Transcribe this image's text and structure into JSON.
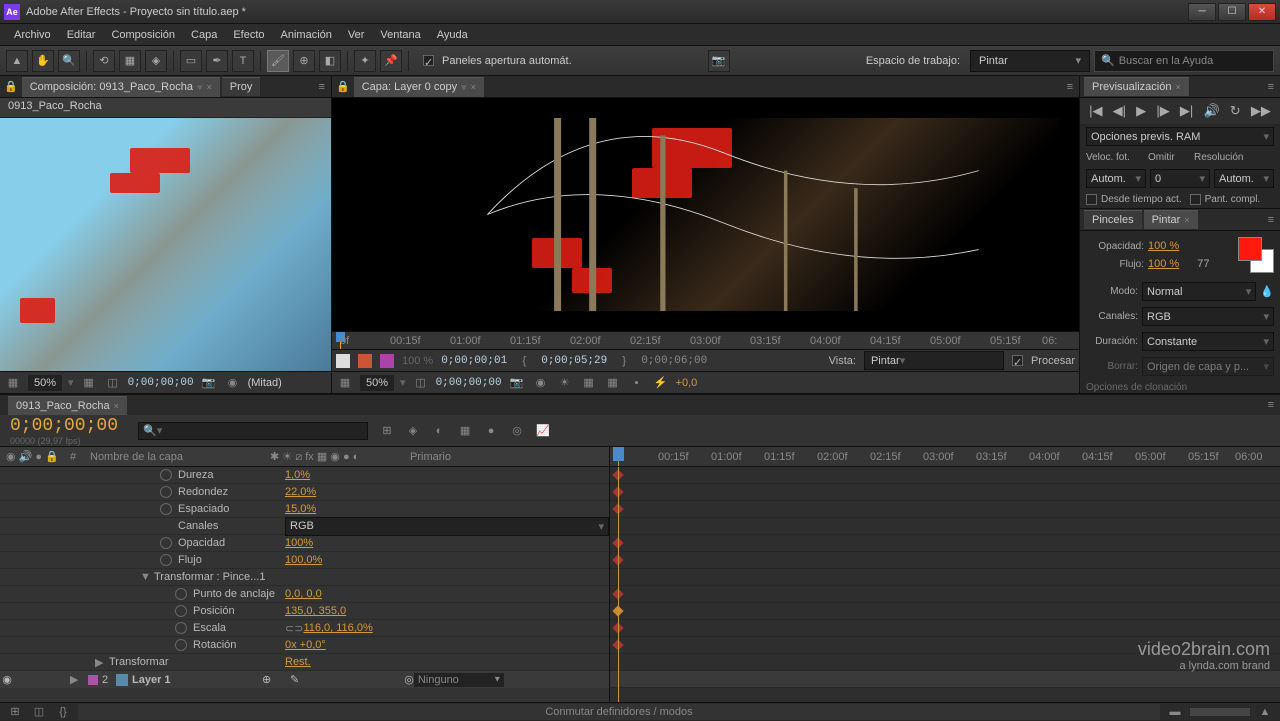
{
  "app": {
    "title": "Adobe After Effects - Proyecto sin título.aep *",
    "icon_text": "Ae"
  },
  "menu": [
    "Archivo",
    "Editar",
    "Composición",
    "Capa",
    "Efecto",
    "Animación",
    "Ver",
    "Ventana",
    "Ayuda"
  ],
  "toolbar": {
    "panels_auto": "Paneles apertura automát.",
    "workspace_label": "Espacio de trabajo:",
    "workspace_value": "Pintar",
    "help_placeholder": "Buscar en la Ayuda"
  },
  "left_panel": {
    "comp_tab": "Composición: 0913_Paco_Rocha",
    "proj_tab": "Proy",
    "comp_name": "0913_Paco_Rocha",
    "zoom": "50%",
    "timecode": "0;00;00;00",
    "resolution": "(Mitad)"
  },
  "center_panel": {
    "layer_tab": "Capa: Layer 0 copy",
    "zoom": "50%",
    "timecode": "0;00;00;00",
    "time_in": "0;00;00;01",
    "time_out": "0;00;05;29",
    "time_cur": "0;00;06;00",
    "vista_label": "Vista:",
    "vista_value": "Pintar",
    "procesar": "Procesar",
    "plus_value": "+0,0",
    "ruler_marks": [
      "0f",
      "00:15f",
      "01:00f",
      "01:15f",
      "02:00f",
      "02:15f",
      "03:00f",
      "03:15f",
      "04:00f",
      "04:15f",
      "05:00f",
      "05:15f",
      "06:"
    ]
  },
  "right_panel": {
    "preview_tab": "Previsualización",
    "ram_preview": "Opciones previs. RAM",
    "frame_rate_label": "Veloc. fot.",
    "skip_label": "Omitir",
    "resolution_label": "Resolución",
    "frame_rate": "Autom.",
    "skip": "0",
    "resolution": "Autom.",
    "from_current": "Desde tiempo act.",
    "full_screen": "Pant. compl.",
    "brushes_tab": "Pinceles",
    "paint_tab": "Pintar",
    "opacity_label": "Opacidad:",
    "opacity_value": "100 %",
    "flow_label": "Flujo:",
    "flow_value": "100 %",
    "size_value": "77",
    "mode_label": "Modo:",
    "mode_value": "Normal",
    "channels_label": "Canales:",
    "channels_value": "RGB",
    "duration_label": "Duración:",
    "duration_value": "Constante",
    "erase_label": "Borrar:",
    "erase_value": "Origen de capa y p...",
    "clone_options": "Opciones de clonación"
  },
  "timeline": {
    "tab": "0913_Paco_Rocha",
    "timecode": "0;00;00;00",
    "fps": "00000 (29,97 fps)",
    "col_num": "#",
    "col_name": "Nombre de la capa",
    "col_parent": "Primario",
    "ruler_marks": [
      "00:15f",
      "01:00f",
      "01:15f",
      "02:00f",
      "02:15f",
      "03:00f",
      "03:15f",
      "04:00f",
      "04:15f",
      "05:00f",
      "05:15f",
      "06:00"
    ],
    "props": [
      {
        "name": "Dureza",
        "value": "1,0%"
      },
      {
        "name": "Redondez",
        "value": "22,0%"
      },
      {
        "name": "Espaciado",
        "value": "15,0%"
      },
      {
        "name": "Canales",
        "value": "RGB",
        "dropdown": true,
        "no_stopwatch": true
      },
      {
        "name": "Opacidad",
        "value": "100%"
      },
      {
        "name": "Flujo",
        "value": "100,0%"
      }
    ],
    "transform_group": "Transformar : Pince...1",
    "transform_props": [
      {
        "name": "Punto de anclaje",
        "value": "0,0, 0,0"
      },
      {
        "name": "Posición",
        "value": "135,0, 355,0"
      },
      {
        "name": "Escala",
        "value": "116,0, 116,0%",
        "link": true
      },
      {
        "name": "Rotación",
        "value": "0x +0,0°"
      }
    ],
    "layer_transform": "Transformar",
    "layer_transform_value": "Rest.",
    "layer_num": "2",
    "layer_name": "Layer 1",
    "parent_value": "Ninguno",
    "footer_toggle": "Conmutar definidores / modos"
  },
  "watermark": {
    "line1": "video2brain.com",
    "line2": "a lynda.com brand"
  }
}
